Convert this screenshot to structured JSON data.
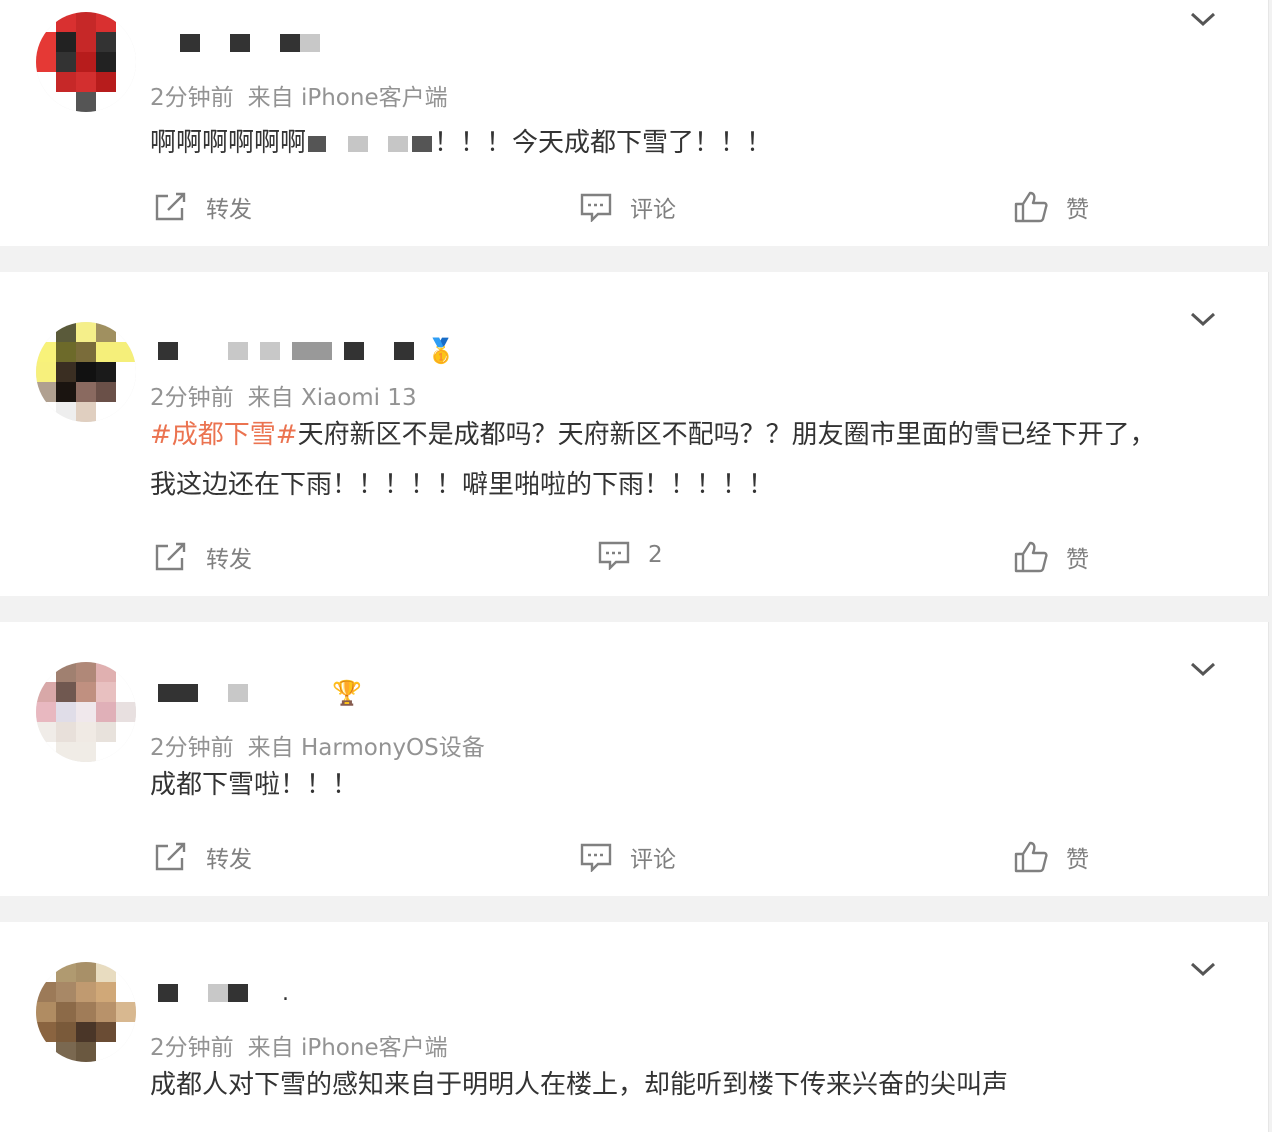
{
  "posts": [
    {
      "name_masked": "■ ■ ■",
      "time": "2分钟前",
      "source": "来自 iPhone客户端",
      "text_prefix": "啊啊啊啊啊啊",
      "text_suffix": "！！！今天成都下雪了！！！",
      "repost_label": "转发",
      "comment_label": "评论",
      "like_label": "赞"
    },
    {
      "name_masked": "■ ■■■ ■",
      "badge": "🥇",
      "time": "2分钟前",
      "source": "来自 Xiaomi 13",
      "topic": "#成都下雪#",
      "text_line1": "天府新区不是成都吗？天府新区不配吗？？朋友圈市里面的雪已经下开了，",
      "text_line2": "我这边还在下雨！！！！！噼里啪啦的下雨！！！！！",
      "repost_label": "转发",
      "comment_label": "2",
      "like_label": "赞"
    },
    {
      "name_masked": "■ ■",
      "badge": "🏆",
      "time": "2分钟前",
      "source": "来自 HarmonyOS设备",
      "text": "成都下雪啦！！！",
      "repost_label": "转发",
      "comment_label": "评论",
      "like_label": "赞"
    },
    {
      "name_masked": "■ ■■ .",
      "time": "2分钟前",
      "source": "来自 iPhone客户端",
      "text": "成都人对下雪的感知来自于明明人在楼上，却能听到楼下传来兴奋的尖叫声"
    }
  ],
  "colors": {
    "topic": "#eb7350",
    "meta": "#939393",
    "action": "#808080",
    "separator": "#f2f2f2"
  },
  "icons": [
    "chevron-down-icon",
    "repost-icon",
    "comment-icon",
    "like-icon"
  ]
}
